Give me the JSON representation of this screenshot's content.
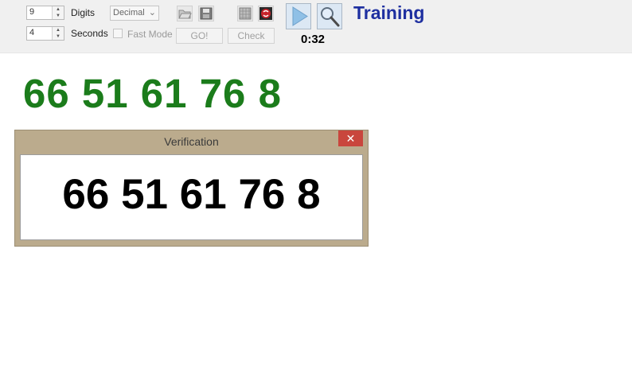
{
  "toolbar": {
    "digits": {
      "value": "9",
      "label": "Digits"
    },
    "seconds": {
      "value": "4",
      "label": "Seconds"
    },
    "mode_select": {
      "value": "Decimal"
    },
    "fast_mode": {
      "label": "Fast Mode",
      "checked": false
    },
    "go_label": "GO!",
    "check_label": "Check",
    "timer": "0:32",
    "title": "Training"
  },
  "main": {
    "sequence": "66 51 61 76 8"
  },
  "dialog": {
    "title": "Verification",
    "close_glyph": "✕",
    "answer": "66 51 61 76 8"
  },
  "icons": [
    "open-folder-icon",
    "save-icon",
    "grid-icon",
    "stop-icon",
    "play-icon",
    "magnifier-icon"
  ],
  "colors": {
    "sequence": "#1b7c1b",
    "title": "#1e2fa0",
    "dialog_frame": "#bbab8d",
    "close": "#c9463d"
  }
}
